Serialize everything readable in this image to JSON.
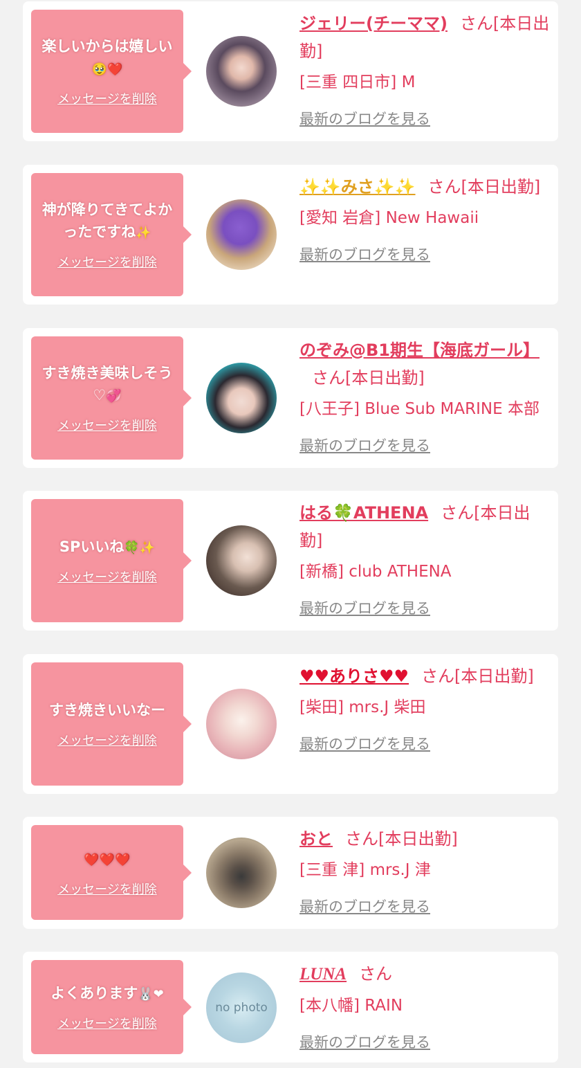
{
  "entries": [
    {
      "message": "楽しいからは嬉しい",
      "message_emoji": "🥹❤️",
      "delete_label": "メッセージを削除",
      "name": "ジェリー(チーママ)",
      "honorific": "さん[本日出勤]",
      "shop": "[三重 四日市] M",
      "blog_label": "最新のブログを見る"
    },
    {
      "message": "神が降りてきてよかったですね",
      "message_emoji": "✨",
      "delete_label": "メッセージを削除",
      "name": "✨✨みさ✨✨",
      "honorific": "さん[本日出勤]",
      "shop": "[愛知 岩倉] New Hawaii",
      "blog_label": "最新のブログを見る"
    },
    {
      "message": "すき焼き美味しそう♡",
      "message_emoji": "💞",
      "delete_label": "メッセージを削除",
      "name": "のぞみ@B1期生【海底ガール】",
      "honorific": "さん[本日出勤]",
      "shop": "[八王子] Blue Sub MARINE 本部",
      "blog_label": "最新のブログを見る"
    },
    {
      "message": "SPいいね",
      "message_emoji": "🍀✨",
      "delete_label": "メッセージを削除",
      "name": "はる🍀ATHENA",
      "honorific": "さん[本日出勤]",
      "shop": "[新橋] club ATHENA",
      "blog_label": "最新のブログを見る"
    },
    {
      "message": "すき焼きいいなー",
      "message_emoji": "",
      "delete_label": "メッセージを削除",
      "name": "♥♥ありさ♥♥",
      "honorific": "さん[本日出勤]",
      "shop": "[柴田] mrs.J 柴田",
      "blog_label": "最新のブログを見る"
    },
    {
      "message": "",
      "message_emoji": "❤️❤️❤️",
      "delete_label": "メッセージを削除",
      "name": "おと",
      "honorific": "さん[本日出勤]",
      "shop": "[三重 津] mrs.J 津",
      "blog_label": "最新のブログを見る"
    },
    {
      "message": "よくあります",
      "message_emoji": "🐰❤",
      "delete_label": "メッセージを削除",
      "name": "LUNA",
      "honorific": "さん",
      "shop": "[本八幡] RAIN",
      "blog_label": "最新のブログを見る",
      "avatar_text": "no photo"
    }
  ],
  "colors": {
    "accent": "#e23d5d",
    "bubble": "#f6949f",
    "muted": "#888888",
    "card": "#ffffff",
    "background": "#f2f2f2"
  }
}
